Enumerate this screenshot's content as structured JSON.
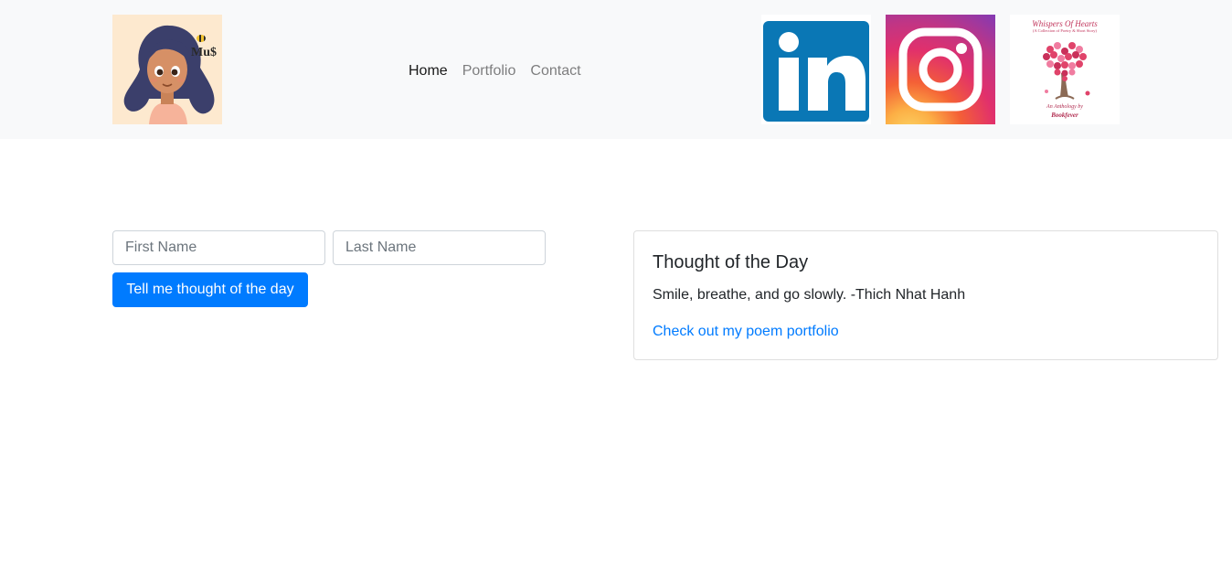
{
  "navbar": {
    "logo": {
      "icon": "girl-avatar-logo",
      "text": "Mu$"
    },
    "links": [
      {
        "label": "Home",
        "active": true
      },
      {
        "label": "Portfolio",
        "active": false
      },
      {
        "label": "Contact",
        "active": false
      }
    ],
    "social": [
      {
        "icon": "linkedin-icon",
        "color": "#0a77b5"
      },
      {
        "icon": "instagram-icon"
      },
      {
        "icon": "book-cover-image",
        "title": "Whispers Of Hearts",
        "subtitle": "(A Collection of Poetry & Short Story)",
        "foot1": "An Anthology by",
        "foot2": "Bookfever"
      }
    ]
  },
  "form": {
    "first_name_placeholder": "First Name",
    "first_name_value": "",
    "last_name_placeholder": "Last Name",
    "last_name_value": "",
    "submit_label": "Tell me thought of the day"
  },
  "card": {
    "title": "Thought of the Day",
    "quote": "Smile, breathe, and go slowly. -Thich Nhat Hanh",
    "link_label": "Check out my poem portfolio"
  },
  "colors": {
    "primary": "#007bff",
    "navbar_bg": "#f8f9fa"
  }
}
